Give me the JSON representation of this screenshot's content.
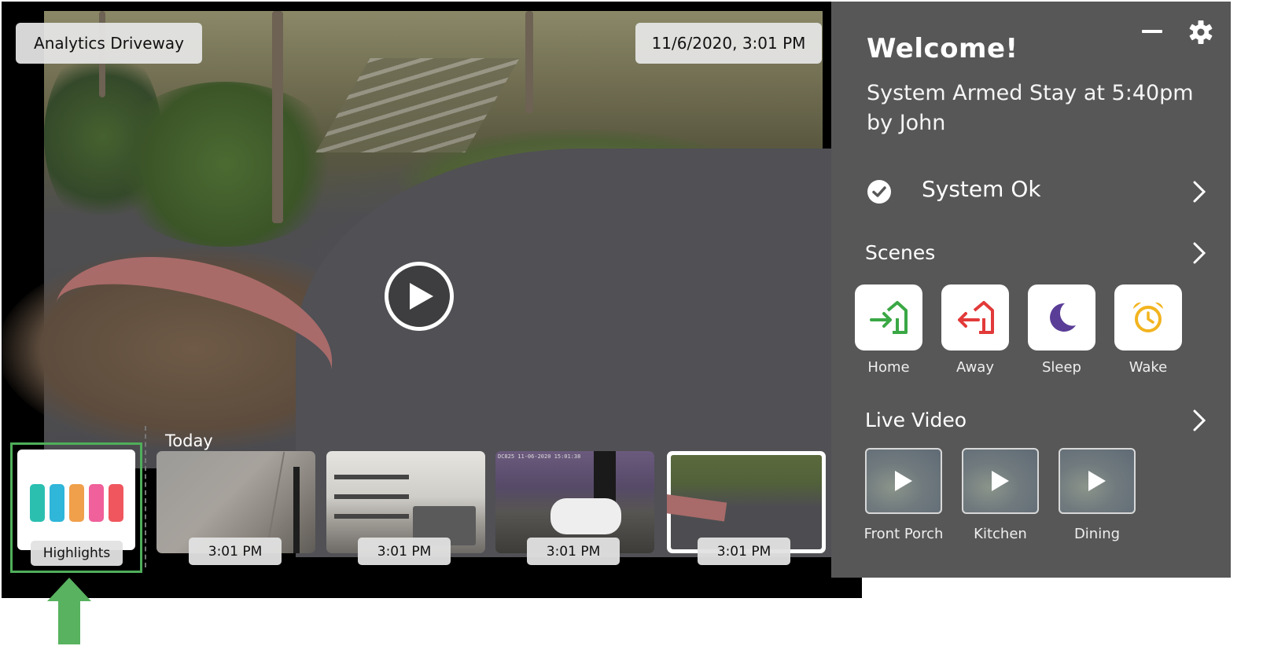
{
  "video": {
    "camera_name": "Analytics Driveway",
    "timestamp": "11/6/2020, 3:01 PM",
    "play_icon": "play-icon"
  },
  "timeline": {
    "day_label": "Today",
    "highlights": {
      "label": "Highlights",
      "bar_colors": [
        "#2bbfb0",
        "#2fb6d9",
        "#f0a04b",
        "#f0609a",
        "#f0565e"
      ]
    },
    "clips": [
      {
        "time": "3:01 PM",
        "overlay": ""
      },
      {
        "time": "3:01 PM",
        "overlay": ""
      },
      {
        "time": "3:01 PM",
        "overlay": "DC825  11-06-2020 15:01:38"
      },
      {
        "time": "3:01 PM",
        "overlay": ""
      }
    ]
  },
  "panel": {
    "welcome": "Welcome!",
    "arming_status": "System Armed Stay at 5:40pm by John",
    "system_status": "System Ok",
    "scenes_title": "Scenes",
    "scenes": [
      {
        "label": "Home",
        "icon": "home-arrive-icon",
        "color": "#3aa845"
      },
      {
        "label": "Away",
        "icon": "home-leave-icon",
        "color": "#e23a3a"
      },
      {
        "label": "Sleep",
        "icon": "moon-icon",
        "color": "#5a3d97"
      },
      {
        "label": "Wake",
        "icon": "alarm-clock-icon",
        "color": "#f2b41f"
      }
    ],
    "live_video_title": "Live Video",
    "live_cameras": [
      {
        "label": "Front Porch"
      },
      {
        "label": "Kitchen"
      },
      {
        "label": "Dining"
      }
    ]
  },
  "annotation": {
    "arrow_color": "#58b25f"
  }
}
